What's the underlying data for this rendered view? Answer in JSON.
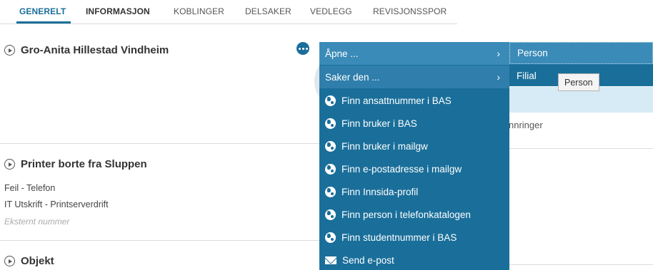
{
  "tabs": [
    {
      "label": "GENERELT",
      "state": "active"
    },
    {
      "label": "INFORMASJON",
      "state": "bold"
    },
    {
      "label": "KOBLINGER",
      "state": "normal"
    },
    {
      "label": "DELSAKER",
      "state": "normal"
    },
    {
      "label": "VEDLEGG",
      "state": "normal"
    },
    {
      "label": "REVISJONSSPOR",
      "state": "normal"
    }
  ],
  "person_section": {
    "title": "Gro-Anita Hillestad Vindheim",
    "icon": "play-circle-icon",
    "more_icon": "ellipsis-icon"
  },
  "case_section": {
    "title": "Printer borte fra Sluppen",
    "icon": "play-circle-icon",
    "category": "Feil  -  Telefon",
    "service": "IT Utskrift   -  Printserverdrift",
    "external_number_placeholder": "Eksternt nummer"
  },
  "object_section": {
    "title": "Objekt",
    "icon": "play-circle-icon"
  },
  "background": {
    "partial_text": "nnringer"
  },
  "context_menu": {
    "items": [
      {
        "label": "Åpne ...",
        "icon": "",
        "has_submenu": true
      },
      {
        "label": "Saker den ...",
        "icon": "",
        "has_submenu": true
      },
      {
        "label": "Finn ansattnummer i BAS",
        "icon": "globe-icon",
        "has_submenu": false
      },
      {
        "label": "Finn bruker i BAS",
        "icon": "globe-icon",
        "has_submenu": false
      },
      {
        "label": "Finn bruker i mailgw",
        "icon": "globe-icon",
        "has_submenu": false
      },
      {
        "label": "Finn e-postadresse i mailgw",
        "icon": "globe-icon",
        "has_submenu": false
      },
      {
        "label": "Finn Innsida-profil",
        "icon": "globe-icon",
        "has_submenu": false
      },
      {
        "label": "Finn person i telefonkatalogen",
        "icon": "globe-icon",
        "has_submenu": false
      },
      {
        "label": "Finn studentnummer i BAS",
        "icon": "globe-icon",
        "has_submenu": false
      },
      {
        "label": "Send e-post",
        "icon": "mail-icon",
        "has_submenu": false
      }
    ],
    "chevron": "›"
  },
  "submenu": {
    "items": [
      {
        "label": "Person"
      },
      {
        "label": "Filial"
      }
    ]
  },
  "tooltip": {
    "text": "Person"
  },
  "colors": {
    "accent": "#1a6f9a",
    "menu_bg": "#1a6f9a",
    "menu_hover": "#3b8bb8",
    "info_band": "#d6ebf5"
  }
}
